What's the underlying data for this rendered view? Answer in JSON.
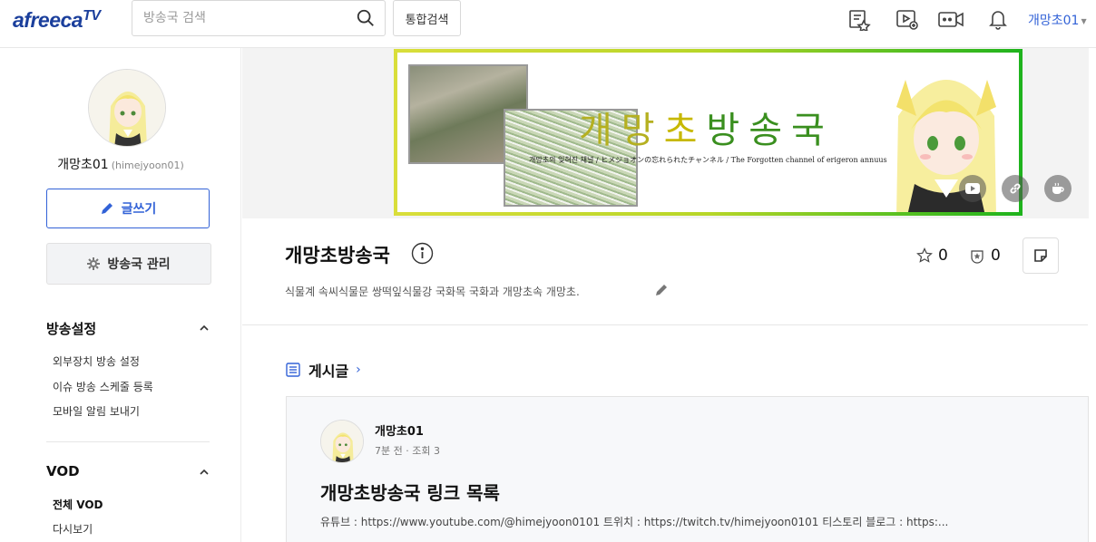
{
  "header": {
    "logo_main": "afreeca",
    "logo_tv": "TV",
    "search_placeholder": "방송국 검색",
    "total_search_label": "통합검색",
    "user_name": "개망초01",
    "icons": [
      "playlist-icon",
      "vod-upload-icon",
      "broadcast-camera-icon",
      "notification-bell-icon"
    ]
  },
  "sidebar": {
    "profile_name": "개망초01",
    "profile_id": "(himejyoon01)",
    "write_label": "글쓰기",
    "manage_label": "방송국 관리",
    "broadcast_settings": {
      "title": "방송설정",
      "items": [
        "외부장치 방송 설정",
        "이슈 방송 스케줄 등록",
        "모바일 알림 보내기"
      ]
    },
    "vod": {
      "title": "VOD",
      "items": [
        "전체 VOD",
        "다시보기"
      ]
    }
  },
  "banner": {
    "title_parts": [
      "개망",
      "초",
      "방송국"
    ],
    "subtitle": "개망초의 잊혀진 채널 / ヒメジョオンの忘れられたチャンネル / The Forgotten channel of erigeron annuus"
  },
  "channel": {
    "title": "개망초방송국",
    "description": "식물계 속씨식물문 쌍떡잎식물강 국화목 국화과 개망초속 개망초.",
    "favorites": "0",
    "subscribers": "0"
  },
  "posts": {
    "section_title": "게시글",
    "items": [
      {
        "author": "개망초01",
        "meta": "7분 전 · 조회 3",
        "title": "개망초방송국 링크 목록",
        "body": "유튜브 : https://www.youtube.com/@himejyoon0101 트위치 : https://twitch.tv/himejyoon0101 티스토리 블로그 : https:..."
      }
    ]
  },
  "colors": {
    "brand_blue": "#1b3f9c",
    "accent_blue": "#3262d7",
    "banner_green": "#1fb31d",
    "banner_yellow": "#d9de3a"
  }
}
